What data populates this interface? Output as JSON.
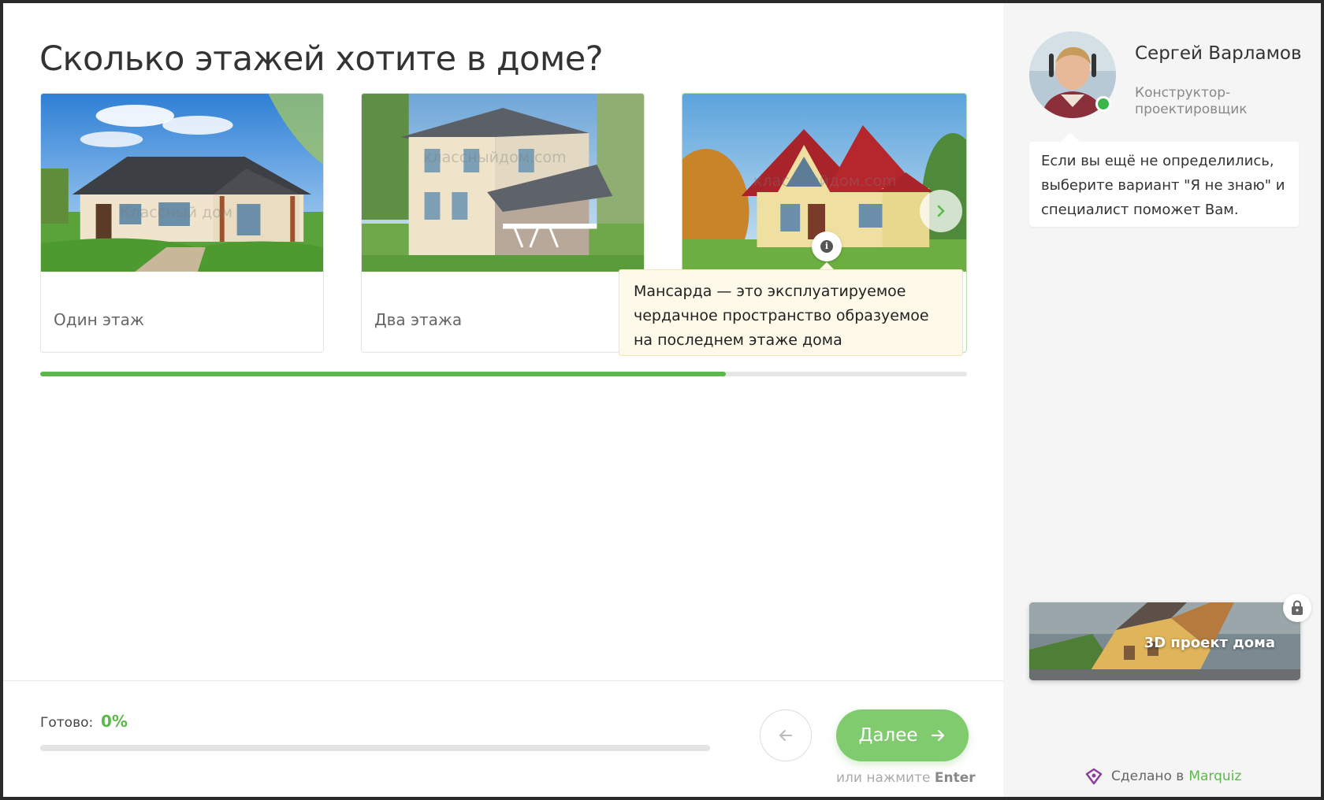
{
  "question": {
    "title": "Сколько этажей хотите в доме?"
  },
  "options": [
    {
      "label": "Один этаж",
      "watermark": "Классный дом"
    },
    {
      "label": "Два этажа",
      "watermark": "классныйдом.com"
    },
    {
      "label": "",
      "watermark": "классныйдом.com"
    }
  ],
  "tooltip": {
    "text": "Мансарда — это эксплуатируемое чердачное пространство образуемое на последнем этаже дома"
  },
  "progress_top": {
    "percent": 74
  },
  "footer": {
    "ready_label": "Готово:",
    "ready_value": "0%",
    "progress_percent": 0,
    "next_label": "Далее",
    "hint_prefix": "или нажмите",
    "hint_key": "Enter"
  },
  "consultant": {
    "name": "Сергей Варламов",
    "role": "Конструктор-проектировщик",
    "message": "Если вы ещё не определились, выберите вариант \"Я не знаю\" и специалист поможет Вам."
  },
  "promo": {
    "label": "3D проект дома"
  },
  "branding": {
    "prefix": "Сделано в",
    "brand": "Marquiz"
  },
  "colors": {
    "accent": "#5cb84b",
    "button": "#7fcb6e",
    "tooltip_bg": "#fef9e9",
    "sidebar_bg": "#f5f5f5"
  },
  "icons": [
    "chevron-right-icon",
    "info-icon",
    "arrow-left-icon",
    "arrow-right-icon",
    "lock-icon",
    "marquiz-logo-icon"
  ]
}
